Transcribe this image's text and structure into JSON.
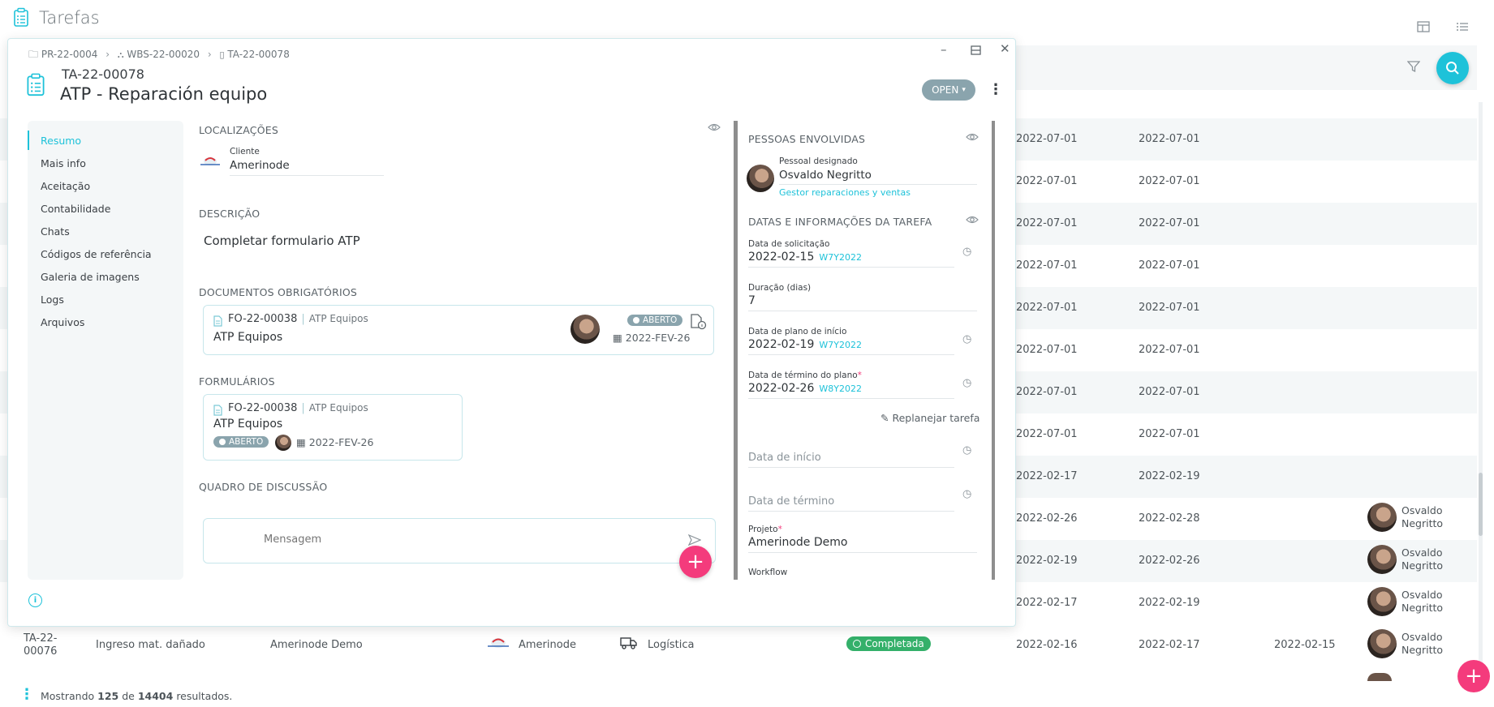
{
  "page": {
    "title": "Tarefas"
  },
  "bg_rows": [
    {
      "start": "2022-07-01",
      "end": "2022-07-01"
    },
    {
      "start": "2022-07-01",
      "end": "2022-07-01"
    },
    {
      "start": "2022-07-01",
      "end": "2022-07-01"
    },
    {
      "start": "2022-07-01",
      "end": "2022-07-01"
    },
    {
      "start": "2022-07-01",
      "end": "2022-07-01"
    },
    {
      "start": "2022-07-01",
      "end": "2022-07-01"
    },
    {
      "start": "2022-07-01",
      "end": "2022-07-01"
    },
    {
      "start": "2022-07-01",
      "end": "2022-07-01"
    },
    {
      "start": "2022-02-17",
      "end": "2022-02-19"
    },
    {
      "start": "2022-02-26",
      "end": "2022-02-28",
      "person": "Osvaldo Negritto"
    },
    {
      "start": "2022-02-19",
      "end": "2022-02-26",
      "person": "Osvaldo Negritto"
    },
    {
      "start": "2022-02-17",
      "end": "2022-02-19",
      "person": "Osvaldo Negritto"
    }
  ],
  "last_row": {
    "id_a": "TA-22-",
    "id_b": "00076",
    "name": "Ingreso mat. dañado",
    "project": "Amerinode Demo",
    "client": "Amerinode",
    "category": "Logística",
    "status": "Completada",
    "start": "2022-02-16",
    "end": "2022-02-17",
    "done": "2022-02-15",
    "person_a": "Osvaldo",
    "person_b": "Negritto"
  },
  "footer": {
    "prefix": "Mostrando",
    "shown": "125",
    "of": "de",
    "total": "14404",
    "suffix": "resultados."
  },
  "modal": {
    "breadcrumb": [
      "PR-22-0004",
      "WBS-22-00020",
      "TA-22-00078"
    ],
    "task_id": "TA-22-00078",
    "task_title": "ATP - Reparación equipo",
    "status_button": "OPEN",
    "nav": [
      "Resumo",
      "Mais info",
      "Aceitação",
      "Contabilidade",
      "Chats",
      "Códigos de referência",
      "Galeria de imagens",
      "Logs",
      "Arquivos"
    ],
    "locations": {
      "heading": "LOCALIZAÇÕES",
      "client_label": "Cliente",
      "client_value": "Amerinode"
    },
    "description": {
      "heading": "DESCRIÇÃO",
      "text": "Completar formulario ATP"
    },
    "required_docs": {
      "heading": "DOCUMENTOS OBRIGATÓRIOS",
      "code": "FO-22-00038",
      "type": "ATP Equipos",
      "name": "ATP Equipos",
      "badge": "ABERTO",
      "date": "2022-FEV-26"
    },
    "forms": {
      "heading": "FORMULÁRIOS",
      "code": "FO-22-00038",
      "type": "ATP Equipos",
      "name": "ATP Equipos",
      "badge": "ABERTO",
      "date": "2022-FEV-26"
    },
    "discussion": {
      "heading": "QUADRO DE DISCUSSÃO",
      "placeholder": "Mensagem"
    },
    "people": {
      "heading": "PESSOAS ENVOLVIDAS",
      "assigned_label": "Pessoal designado",
      "assigned_name": "Osvaldo Negritto",
      "assigned_role": "Gestor reparaciones y ventas"
    },
    "dates": {
      "heading": "DATAS E INFORMAÇÕES DA TAREFA",
      "request_label": "Data de solicitação",
      "request_value": "2022-02-15",
      "request_week": "W7Y2022",
      "duration_label": "Duração (dias)",
      "duration_value": "7",
      "plan_start_label": "Data de plano de início",
      "plan_start_value": "2022-02-19",
      "plan_start_week": "W7Y2022",
      "plan_end_label": "Data de término do plano",
      "plan_end_value": "2022-02-26",
      "plan_end_week": "W8Y2022",
      "replan": "Replanejar tarefa",
      "start_placeholder": "Data de início",
      "end_placeholder": "Data de término",
      "project_label": "Projeto",
      "project_value": "Amerinode Demo",
      "workflow_label": "Workflow"
    }
  }
}
